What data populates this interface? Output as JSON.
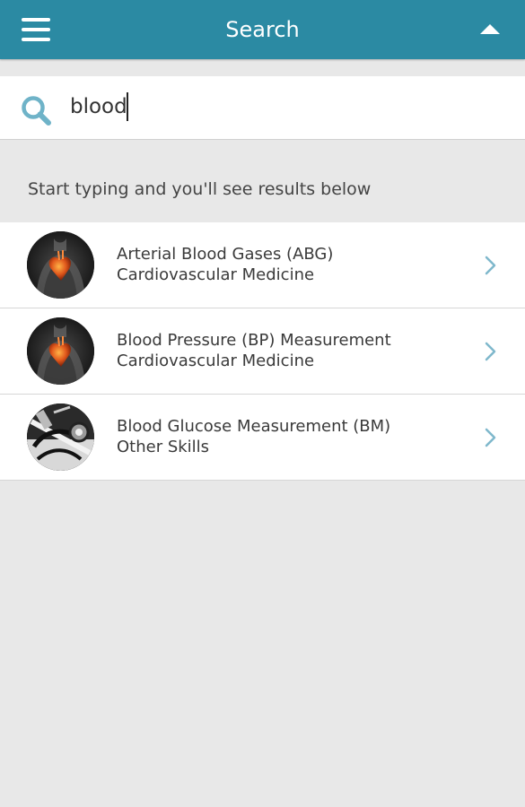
{
  "header": {
    "title": "Search",
    "menu_icon": "hamburger-menu-icon",
    "collapse_icon": "triangle-up-icon",
    "background_color": "#2b8aa3"
  },
  "search": {
    "value": "blood",
    "icon": "search-icon",
    "icon_color": "#6fb3c8"
  },
  "hint": "Start typing and you'll see results below",
  "results": [
    {
      "title": "Arterial Blood Gases (ABG)",
      "category": "Cardiovascular Medicine",
      "thumbnail": "heart-thumbnail-icon"
    },
    {
      "title": "Blood Pressure (BP) Measurement",
      "category": "Cardiovascular Medicine",
      "thumbnail": "heart-thumbnail-icon"
    },
    {
      "title": "Blood Glucose Measurement (BM)",
      "category": "Other Skills",
      "thumbnail": "stethoscope-thumbnail-icon"
    }
  ],
  "chevron_color": "#7fb8cc"
}
